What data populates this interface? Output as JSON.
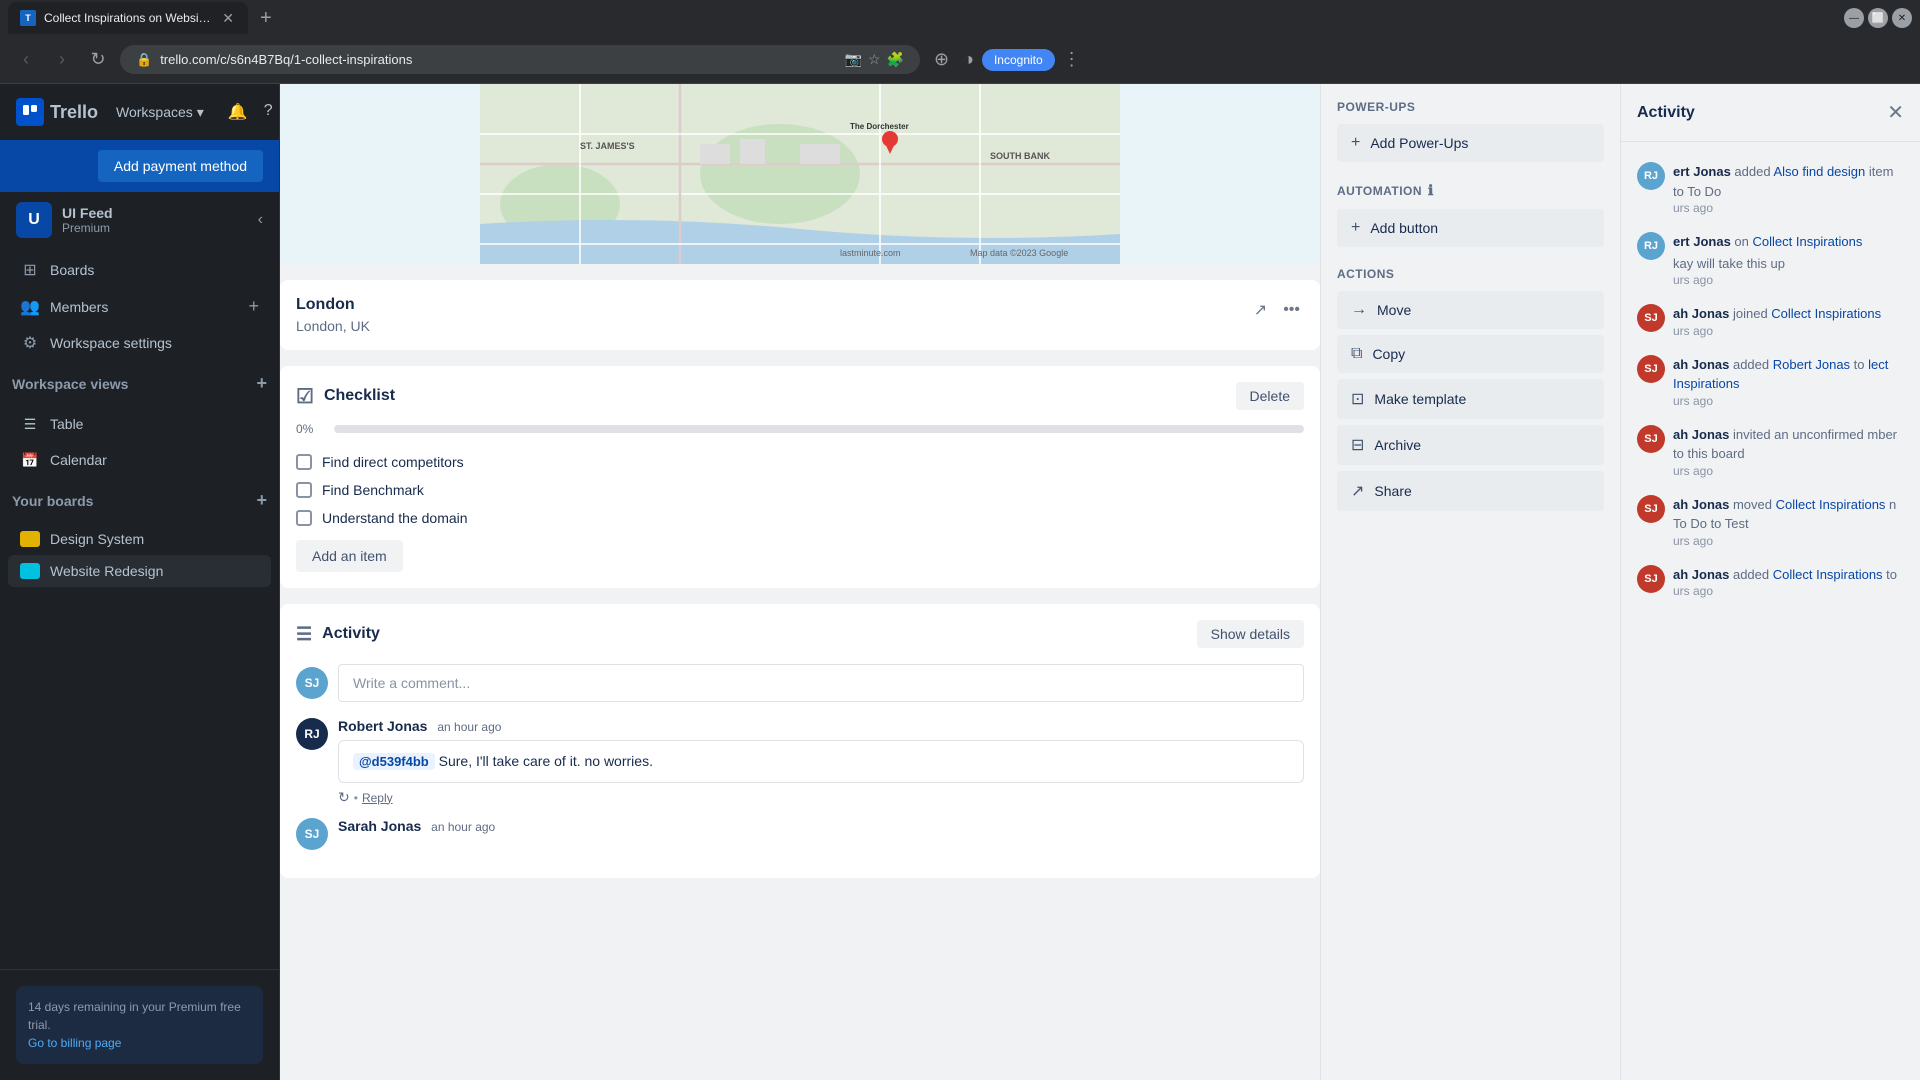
{
  "browser": {
    "tab_title": "Collect Inspirations on Website R...",
    "url": "trello.com/c/s6n4B7Bq/1-collect-inspirations",
    "new_tab_label": "+",
    "incognito_label": "Incognito"
  },
  "sidebar": {
    "workspace_initial": "U",
    "workspace_name": "UI Feed",
    "workspace_plan": "Premium",
    "nav_items": [
      {
        "label": "Boards",
        "icon": "⊞"
      },
      {
        "label": "Members",
        "icon": "👥"
      },
      {
        "label": "Workspace settings",
        "icon": "⚙"
      }
    ],
    "workspace_views_label": "Workspace views",
    "table_label": "Table",
    "calendar_label": "Calendar",
    "your_boards_label": "Your boards",
    "boards": [
      {
        "label": "Design System",
        "color": "#e2b203"
      },
      {
        "label": "Website Redesign",
        "color": "#00c2e0"
      }
    ],
    "premium_notice": "14 days remaining in your Premium free trial.",
    "billing_link": "Go to billing page"
  },
  "location": {
    "name": "London",
    "subtitle": "London, UK"
  },
  "checklist": {
    "title": "Checklist",
    "delete_btn": "Delete",
    "progress": "0%",
    "progress_value": 0,
    "items": [
      {
        "label": "Find direct competitors",
        "checked": false
      },
      {
        "label": "Find Benchmark",
        "checked": false
      },
      {
        "label": "Understand the domain",
        "checked": false
      }
    ],
    "add_item_label": "Add an item"
  },
  "activity_section": {
    "title": "Activity",
    "show_details_btn": "Show details",
    "comment_placeholder": "Write a comment...",
    "comments": [
      {
        "author": "Robert Jonas",
        "time": "an hour ago",
        "mention": "@d539f4bb",
        "text": "Sure, I'll take care of it. no worries.",
        "avatar_initials": "RJ",
        "avatar_color": "#172b4d"
      },
      {
        "author": "Sarah Jonas",
        "time": "an hour ago",
        "avatar_initials": "SJ",
        "avatar_color": "#5ba4cf"
      }
    ]
  },
  "actions_panel": {
    "power_ups_label": "Power-Ups",
    "add_power_ups_label": "Add Power-Ups",
    "automation_label": "Automation",
    "add_button_label": "Add button",
    "actions_label": "Actions",
    "move_label": "Move",
    "copy_label": "Copy",
    "make_template_label": "Make template",
    "archive_label": "Archive",
    "share_label": "Share",
    "info_icon": "ℹ"
  },
  "far_right_panel": {
    "title": "Activity",
    "items": [
      {
        "bold": "ert Jonas",
        "text": " added ",
        "link": "Also find design",
        "text2": "",
        "suffix": " item to To Do",
        "time": "urs ago"
      },
      {
        "bold": "ert Jonas",
        "text": " on ",
        "link": "Collect Inspirations",
        "time": "urs ago",
        "extra": "kay will take this up"
      },
      {
        "bold": "ah Jonas",
        "text": " joined ",
        "link": "Collect Inspirations",
        "time": "urs ago"
      },
      {
        "bold": "ah Jonas",
        "text": " added ",
        "link2": "Robert Jonas",
        "text2": " to",
        "link3": "lect Inspirations",
        "time": "urs ago"
      },
      {
        "bold": "ah Jonas",
        "text": " invited an unconfirmed",
        "suffix": " mber to this board",
        "time": "urs ago"
      },
      {
        "bold": "ah Jonas",
        "text": " moved ",
        "link": "Collect Inspirations",
        "suffix": " n To Do to Test",
        "time": "urs ago"
      },
      {
        "bold": "ah Jonas",
        "text": " added ",
        "link": "Collect Inspirations",
        "suffix": " to",
        "time": "urs ago"
      }
    ]
  },
  "colors": {
    "trello_blue": "#0747a6",
    "accent": "#0052cc",
    "sidebar_bg": "#1d2125"
  }
}
